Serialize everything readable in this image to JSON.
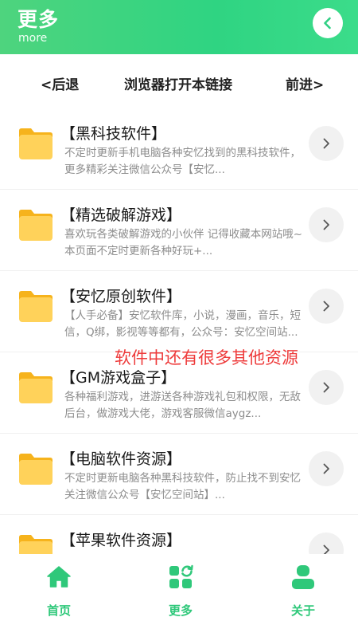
{
  "header": {
    "title": "更多",
    "subtitle": "more",
    "back_icon": "chevron-left-icon",
    "color": "#2fd482"
  },
  "navbar": {
    "back": "<后退",
    "open_browser": "浏览器打开本链接",
    "forward": "前进>"
  },
  "list": {
    "items": [
      {
        "title": "【黑科技软件】",
        "desc": "不定时更新手机电脑各种安忆找到的黑科技软件，更多精彩关注微信公众号【安忆..."
      },
      {
        "title": "【精选破解游戏】",
        "desc": "喜欢玩各类破解游戏的小伙伴 记得收藏本网站哦~本页面不定时更新各种好玩+..."
      },
      {
        "title": "【安忆原创软件】",
        "desc": "【人手必备】安忆软件库，小说，漫画，音乐，短信，Q绑，影视等等都有，公众号：安忆空间站..."
      },
      {
        "title": "【GM游戏盒子】",
        "desc": "各种福利游戏，进游送各种游戏礼包和权限，无敌后台，做游戏大佬，游戏客服微信aygz..."
      },
      {
        "title": "【电脑软件资源】",
        "desc": "不定时更新电脑各种黑科技软件，防止找不到安忆关注微信公众号【安忆空间站】..."
      },
      {
        "title": "【苹果软件资源】",
        "desc": ""
      }
    ]
  },
  "overlay_note": "软件中还有很多其他资源",
  "tabbar": {
    "home": "首页",
    "more": "更多",
    "about": "关于",
    "accent": "#2fc87a"
  }
}
